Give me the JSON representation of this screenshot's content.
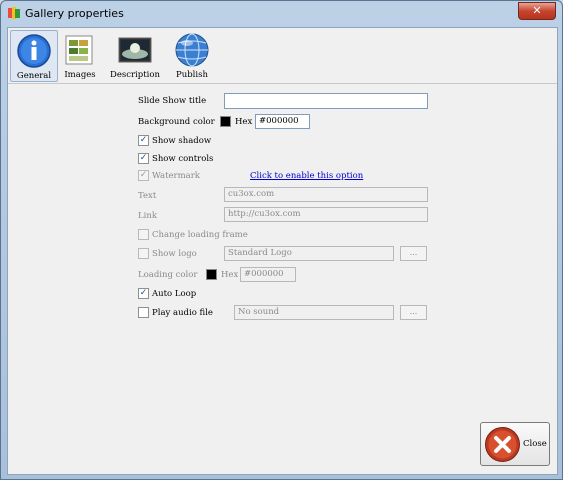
{
  "window": {
    "title": "Gallery properties",
    "close_glyph": "✕"
  },
  "toolbar": {
    "general": "General",
    "images": "Images",
    "description": "Description",
    "publish": "Publish"
  },
  "form": {
    "slideshow_title_label": "Slide Show title",
    "slideshow_title_value": "",
    "bg_color_label": "Background color",
    "bg_hex_label": "Hex",
    "bg_hex_value": "#000000",
    "show_shadow_label": "Show shadow",
    "show_shadow_checked": true,
    "show_controls_label": "Show controls",
    "show_controls_checked": true,
    "watermark_label": "Watermark",
    "watermark_checked": true,
    "watermark_link": "Click to enable this option",
    "text_label": "Text",
    "text_value": "cu3ox.com",
    "link_label": "Link",
    "link_value": "http://cu3ox.com",
    "change_loading_frame_label": "Change loading frame",
    "show_logo_label": "Show logo",
    "logo_value": "Standard Logo",
    "browse_label": "...",
    "loading_color_label": "Loading color",
    "loading_hex_label": "Hex",
    "loading_hex_value": "#000000",
    "auto_loop_label": "Auto Loop",
    "auto_loop_checked": true,
    "play_audio_label": "Play audio file",
    "audio_value": "No sound",
    "check_glyph": "✓"
  },
  "footer": {
    "close_label": "Close"
  },
  "colors": {
    "accent": "#1c4f9c",
    "link": "#0000cc",
    "close_red": "#c6452f"
  }
}
